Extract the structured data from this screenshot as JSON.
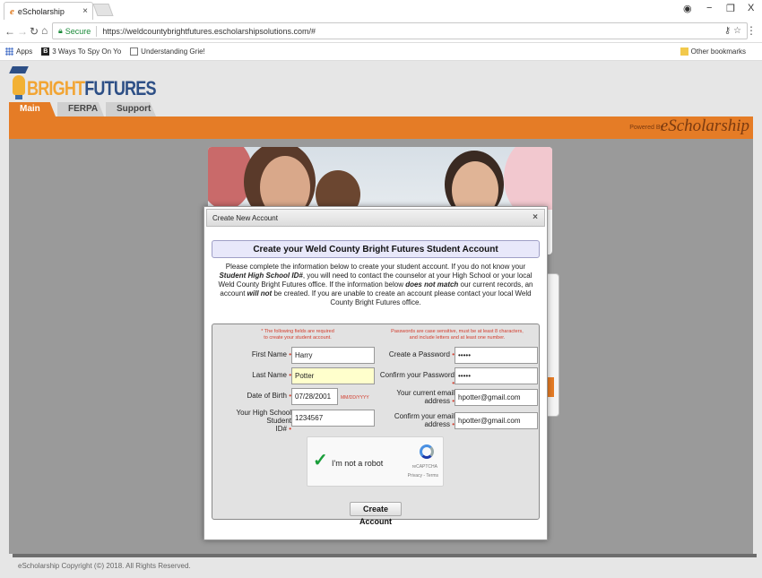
{
  "browser": {
    "tab_title": "eScholarship",
    "tab_logo": "e",
    "tab_close": "×",
    "secure_label": "Secure",
    "url": "https://weldcountybrightfutures.escholarshipsolutions.com/#",
    "window_controls": [
      "◉",
      "−",
      "❐",
      "X"
    ],
    "bookmarks": [
      "Apps",
      "3 Ways To Spy On Yo",
      "Understanding Grie!"
    ],
    "bookmarks_b_icon": "B",
    "other_bookmarks": "Other bookmarks"
  },
  "header": {
    "logo_part1": "BRIGHT",
    "logo_part2": "FUTURES",
    "nav_tabs": [
      "Main",
      "FERPA",
      "Support"
    ],
    "powered_by": "Powered By",
    "brand": "eScholarship"
  },
  "footer": {
    "copyright": "eScholarship Copyright (©) 2018. All Rights Reserved."
  },
  "modal": {
    "title": "Create New Account",
    "close": "×",
    "heading": "Create your Weld County Bright Futures Student Account",
    "intro": {
      "p1": "Please complete the information below to create your student account. If you do not know your ",
      "id_term": "Student High School ID#",
      "p2": ", you will need to contact the counselor at your High School or your local Weld County Bright Futures office. If the information below ",
      "not_match": "does not match",
      "p3": " our current records, an account ",
      "not_created": "will not",
      "p4": " be created. If you are unable to create an account please contact your local Weld County Bright Futures office."
    },
    "required_note_line1": "* The following fields are required",
    "required_note_line2": "to create your student account.",
    "password_note_line1": "Passwords are case sensitive, must be at least 8 characters,",
    "password_note_line2": "and include letters and at least one number.",
    "fields": {
      "first_name": {
        "label": "First Name",
        "value": "Harry"
      },
      "last_name": {
        "label": "Last Name",
        "value": "Potter"
      },
      "dob": {
        "label": "Date of Birth",
        "value": "07/28/2001",
        "format": "MM/DD/YYYY"
      },
      "student_id": {
        "label_line1": "Your High School Student",
        "label_line2": "ID#",
        "value": "1234567"
      },
      "password": {
        "label": "Create a Password",
        "value": "•••••"
      },
      "confirm_password": {
        "label": "Confirm your Password",
        "value": "•••••"
      },
      "email": {
        "label_line1": "Your current email",
        "label_line2": "address",
        "value": "hpotter@gmail.com"
      },
      "confirm_email": {
        "label_line1": "Confirm your email",
        "label_line2": "address",
        "value": "hpotter@gmail.com"
      }
    },
    "required_marker": "•",
    "captcha": {
      "label": "I'm not a robot",
      "brand": "reCAPTCHA",
      "links": "Privacy - Terms"
    },
    "submit_label": "Create Account"
  },
  "colors": {
    "accent_orange": "#e57c26",
    "logo_gold": "#f2a534",
    "logo_navy": "#2d4f86",
    "required_red": "#d23b2b",
    "secure_green": "#1b8a3a"
  }
}
